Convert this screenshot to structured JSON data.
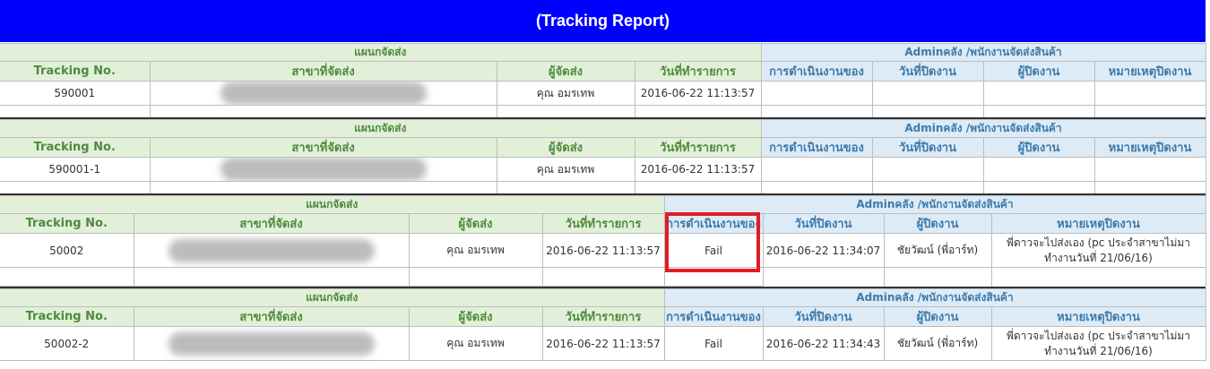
{
  "page": {
    "title": "(Tracking Report)"
  },
  "headers": {
    "group_left": "แผนกจัดส่ง",
    "group_right": "Adminคลัง /พนักงานจัดส่งสินค้า",
    "tracking_no": "Tracking No.",
    "branch": "สาขาที่จัดส่ง",
    "sender": "ผู้จัดส่ง",
    "record_date": "วันที่ทำรายการ",
    "operation": "การดำเนินงานของ",
    "close_date": "วันที่ปิดงาน",
    "closer": "ผู้ปิดงาน",
    "close_note": "หมายเหตุปิดงาน"
  },
  "records": [
    {
      "tracking_no": "590001",
      "sender": "คุณ อมรเทพ",
      "record_date": "2016-06-22 11:13:57",
      "status": "",
      "close_date": "",
      "closer": "",
      "note": ""
    },
    {
      "tracking_no": "590001-1",
      "sender": "คุณ อมรเทพ",
      "record_date": "2016-06-22 11:13:57",
      "status": "",
      "close_date": "",
      "closer": "",
      "note": ""
    },
    {
      "tracking_no": "50002",
      "sender": "คุณ อมรเทพ",
      "record_date": "2016-06-22 11:13:57",
      "status": "Fail",
      "close_date": "2016-06-22 11:34:07",
      "closer": "ชัยวัฒน์ (พี่อาร์ท)",
      "note": "พี่ดาวจะไปส่งเอง (pc ประจำสาขาไม่มาทำงานวันที่ 21/06/16)"
    },
    {
      "tracking_no": "50002-2",
      "sender": "คุณ อมรเทพ",
      "record_date": "2016-06-22 11:13:57",
      "status": "Fail",
      "close_date": "2016-06-22 11:34:43",
      "closer": "ชัยวัฒน์ (พี่อาร์ท)",
      "note": "พี่ดาวจะไปส่งเอง (pc ประจำสาขาไม่มาทำงานวันที่ 21/06/16)"
    }
  ]
}
